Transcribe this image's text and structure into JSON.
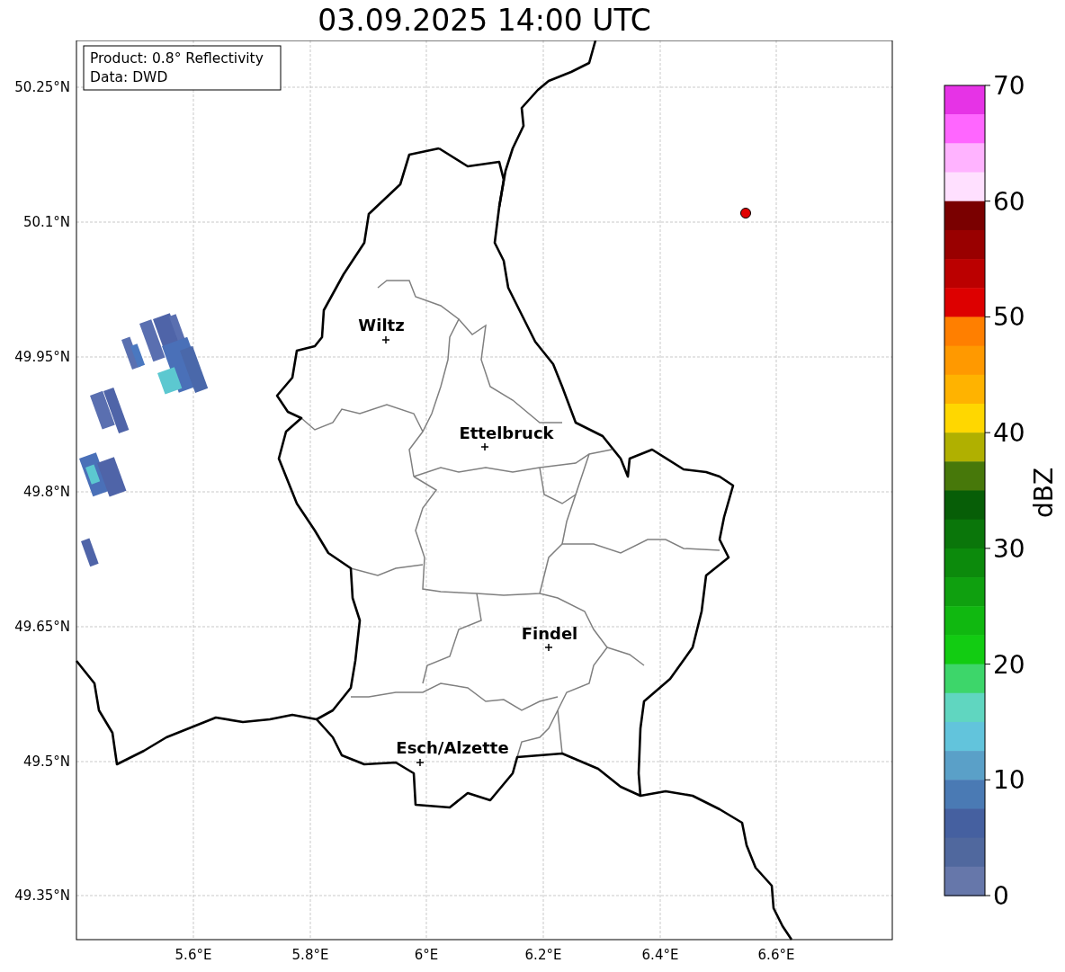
{
  "title": "03.09.2025 14:00 UTC",
  "info_box": [
    "Product: 0.8° Reflectivity",
    "Data: DWD"
  ],
  "lat_ticks": [
    "50.25°N",
    "50.1°N",
    "49.95°N",
    "49.8°N",
    "49.65°N",
    "49.5°N",
    "49.35°N"
  ],
  "lon_ticks": [
    "5.6°E",
    "5.8°E",
    "6°E",
    "6.2°E",
    "6.4°E",
    "6.6°E"
  ],
  "cities": [
    {
      "name": "Wiltz"
    },
    {
      "name": "Ettelbruck"
    },
    {
      "name": "Findel"
    },
    {
      "name": "Esch/Alzette"
    }
  ],
  "colorbar": {
    "label": "dBZ",
    "ticks": [
      "70",
      "60",
      "50",
      "40",
      "30",
      "20",
      "10",
      "0"
    ],
    "segments": [
      {
        "color": "#e633e6"
      },
      {
        "color": "#ff66ff"
      },
      {
        "color": "#ffb3ff"
      },
      {
        "color": "#ffe0ff"
      },
      {
        "color": "#7a0000"
      },
      {
        "color": "#990000"
      },
      {
        "color": "#bb0000"
      },
      {
        "color": "#dd0000"
      },
      {
        "color": "#ff7f00"
      },
      {
        "color": "#ff9900"
      },
      {
        "color": "#ffb300"
      },
      {
        "color": "#ffd700"
      },
      {
        "color": "#b0b000"
      },
      {
        "color": "#47780a"
      },
      {
        "color": "#075e07"
      },
      {
        "color": "#0a760a"
      },
      {
        "color": "#0c8a0c"
      },
      {
        "color": "#0fa00f"
      },
      {
        "color": "#10b810"
      },
      {
        "color": "#12cc12"
      },
      {
        "color": "#3dd66a"
      },
      {
        "color": "#60d6c0"
      },
      {
        "color": "#62c4dc"
      },
      {
        "color": "#5aa0c8"
      },
      {
        "color": "#4a7ab4"
      },
      {
        "color": "#4560a0"
      },
      {
        "color": "#50689e"
      },
      {
        "color": "#6677aa"
      }
    ]
  }
}
